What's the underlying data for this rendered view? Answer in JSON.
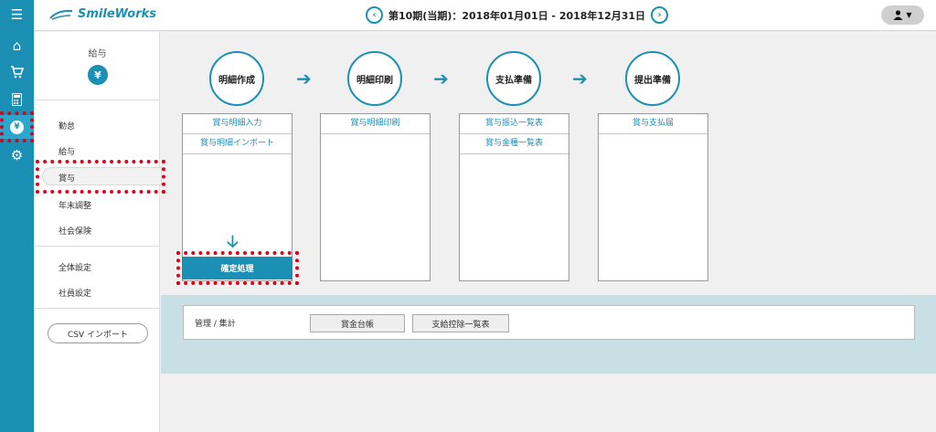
{
  "app": {
    "logo_text": "SmileWorks"
  },
  "header": {
    "period": "第10期(当期)：2018年01月01日 - 2018年12月31日",
    "prev_icon": "chevron-left-icon",
    "next_icon": "chevron-right-icon",
    "user_icon": "user-icon"
  },
  "rail": {
    "items": [
      {
        "icon": "menu-icon",
        "glyph": "☰"
      },
      {
        "icon": "home-icon",
        "glyph": "⌂"
      },
      {
        "icon": "cart-icon",
        "glyph": "🛒"
      },
      {
        "icon": "calculator-icon",
        "glyph": "▦"
      },
      {
        "icon": "payroll-icon",
        "glyph": "¥",
        "active": true
      },
      {
        "icon": "gear-icon",
        "glyph": "⚙"
      }
    ]
  },
  "sidebar": {
    "title": "給与",
    "icon": "yen-bag-icon",
    "icon_glyph": "¥",
    "items": [
      "勤怠",
      "給与",
      "賞与",
      "年末調整",
      "社会保険"
    ],
    "active": "賞与",
    "settings": [
      "全体設定",
      "社員設定"
    ],
    "csv_button": "CSV インポート"
  },
  "steps": [
    {
      "label": "明細作成",
      "links": [
        "賞与明細入力",
        "賞与明細インポート"
      ]
    },
    {
      "label": "明細印刷",
      "links": [
        "賞与明細印刷"
      ]
    },
    {
      "label": "支払準備",
      "links": [
        "賞与振込一覧表",
        "賞与金種一覧表"
      ]
    },
    {
      "label": "提出準備",
      "links": [
        "賞与支払届"
      ]
    }
  ],
  "confirm_button": "確定処理",
  "management": {
    "label": "管理 / 集計",
    "buttons": [
      "賞金台帳",
      "支給控除一覧表"
    ]
  },
  "colors": {
    "accent": "#1b8fb4",
    "highlight": "#e0001a"
  }
}
